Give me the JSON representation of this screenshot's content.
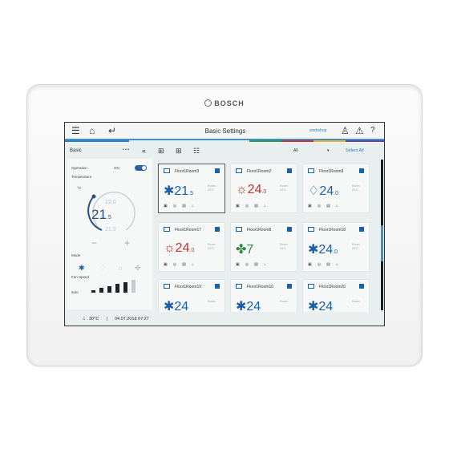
{
  "brand": {
    "name": "BOSCH"
  },
  "topbar": {
    "menu_icon": "hamburger-icon",
    "home_icon": "home-icon",
    "back_icon": "back-arrow-icon",
    "title": "Basic Settings",
    "user": "workshop",
    "user_icon": "user-icon",
    "warning_icon": "warning-icon",
    "help_icon": "help-icon",
    "stripe_colors": [
      "#2b7fd1",
      "#2f9a47",
      "#d62d2d",
      "#f0b428",
      "#6b3fa3"
    ]
  },
  "toolbar": {
    "group": "Basic",
    "more": "• • •",
    "collapse": "«",
    "filter": "All",
    "select_all": "Select All"
  },
  "left": {
    "operation_label": "Operation",
    "operation_value": "ON",
    "temperature_label": "Temperature",
    "unit": "°C",
    "setpoint_high": "22.0",
    "current": "21",
    "current_dec": ".5",
    "setpoint_low": "21.0",
    "minus": "−",
    "plus": "+",
    "mode_label": "Mode",
    "fan_label": "Fan Speed",
    "fan_value": "auto",
    "fan_levels": 6,
    "fan_level_selected": 5,
    "accent": "#1a5fa8"
  },
  "tiles": [
    {
      "name": "Floor1Room3",
      "glyph": "✱",
      "val": "21",
      "dec": ".5",
      "color": "#1a5fa8",
      "selected": true,
      "meta1": "Room",
      "meta2": "21°C"
    },
    {
      "name": "Floor1Room2",
      "glyph": "☼",
      "val": "24",
      "dec": ".0",
      "color": "#c9302c",
      "selected": false,
      "meta1": "Room",
      "meta2": "24°C"
    },
    {
      "name": "Floor1Room9",
      "glyph": "♢",
      "val": "24",
      "dec": ".0",
      "color": "#1a5fa8",
      "selected": false,
      "meta1": "Room",
      "meta2": "24°C"
    },
    {
      "name": "Floor1Room17",
      "glyph": "☼",
      "val": "24",
      "dec": ".0",
      "color": "#c9302c",
      "selected": false,
      "meta1": "Room",
      "meta2": "24°C"
    },
    {
      "name": "Floor1Room8",
      "glyph": "✤",
      "val": "7",
      "dec": "",
      "color": "#2f8a3e",
      "selected": false,
      "meta1": "Room",
      "meta2": "24°C"
    },
    {
      "name": "Floor1Room18",
      "glyph": "✱",
      "val": "24",
      "dec": ".0",
      "color": "#1a5fa8",
      "selected": false,
      "meta1": "Room",
      "meta2": "24°C"
    },
    {
      "name": "Floor1Room19",
      "glyph": "✱",
      "val": "24",
      "dec": "",
      "color": "#1a5fa8",
      "selected": false,
      "meta1": "Room",
      "meta2": ""
    },
    {
      "name": "Floor1Room10",
      "glyph": "✱",
      "val": "24",
      "dec": "",
      "color": "#1a5fa8",
      "selected": false,
      "meta1": "Room",
      "meta2": ""
    },
    {
      "name": "Floor1Room20",
      "glyph": "✱",
      "val": "24",
      "dec": "",
      "color": "#1a5fa8",
      "selected": false,
      "meta1": "Room",
      "meta2": ""
    }
  ],
  "footer": {
    "outdoor_icon": "outdoor-temp-icon",
    "outdoor_temp": "30°C",
    "separator": "|",
    "datetime": "04.07.2018 07:27"
  }
}
